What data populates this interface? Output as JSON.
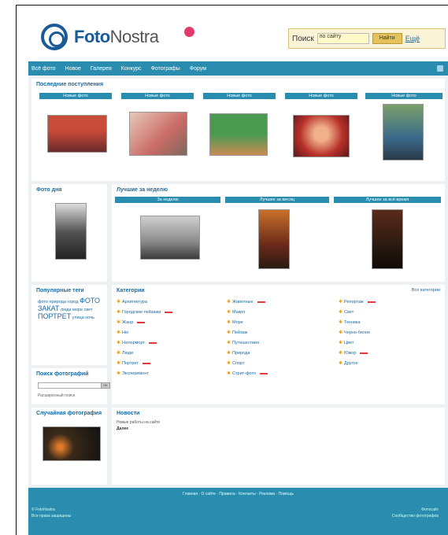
{
  "header": {
    "logo_a": "Foto",
    "logo_b": "Nostra",
    "search_label": "Поиск",
    "search_value": "по сайту",
    "search_button": "Найти",
    "search_advanced": "Ещё"
  },
  "nav": {
    "items": [
      "Всё фото",
      "Новое",
      "Галерея",
      "Конкурс",
      "Фотографы",
      "Форум"
    ]
  },
  "sections": {
    "latest_title": "Последние поступления",
    "latest_heads": [
      "Новые фото",
      "Новые фото",
      "Новые фото",
      "Новые фото",
      "Новые фото"
    ],
    "best_title": "Фото дня",
    "photos_day_title": "Лучшие за неделю",
    "photos_day_heads": [
      "За неделю",
      "Лучшее за месяц",
      "Лучшее за всё время"
    ],
    "tags_title": "Популярные теги",
    "tags_text": "фото природа город",
    "tags_big": "ФОТО",
    "tags_big2": "ЗАКАТ",
    "tags_more": "люди море свет",
    "tags_big3": "ПОРТРЕТ",
    "tags_rest": "улица ночь",
    "search_photo_title": "Поиск фотографий",
    "search_go": "OK",
    "search_hint": "Расширенный поиск",
    "random_title": "Случайная фотография",
    "categories_title": "Категории",
    "categories_all": "Все категории",
    "news_title": "Новости",
    "news_text": "Новые работы на сайте",
    "news_more": "Далее"
  },
  "categories": {
    "col1": [
      "Архитектура",
      "Городские пейзажи",
      "Жанр",
      "Ню",
      "Натюрморт",
      "Люди",
      "Портрет",
      "Эксперимент"
    ],
    "col2": [
      "Животные",
      "Макро",
      "Море",
      "Пейзаж",
      "Путешествия",
      "Природа",
      "Спорт",
      "Стрит-фото"
    ],
    "col3": [
      "Репортаж",
      "Свет",
      "Техника",
      "Черно-белое",
      "Цвет",
      "Юмор",
      "Другое",
      ""
    ]
  },
  "footer": {
    "links": "Главная · О сайте · Правила · Контакты · Реклама · Помощь",
    "left1": "© FotoNostra",
    "left2": "Все права защищены",
    "right1": "Фотосайт",
    "right2": "Сообщество фотографов"
  }
}
